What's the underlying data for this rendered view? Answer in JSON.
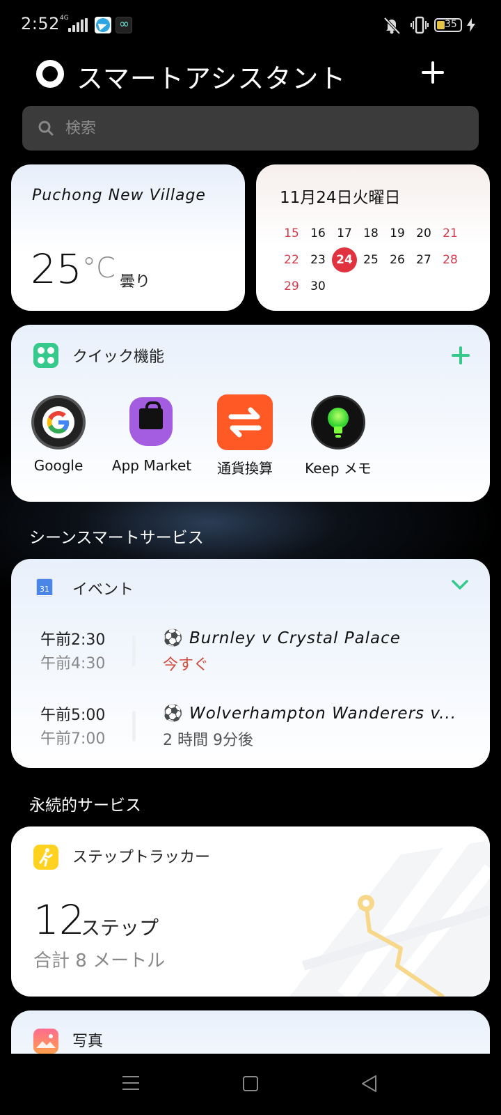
{
  "status": {
    "time": "2:52",
    "network": "4G",
    "battery": "35"
  },
  "header": {
    "title": "スマートアシスタント",
    "add_icon": "plus-icon"
  },
  "search": {
    "placeholder": "検索"
  },
  "weather": {
    "location": "Puchong New Village",
    "temperature": "25",
    "unit": "°C",
    "condition": "曇り"
  },
  "calendar": {
    "date_label": "11月24日火曜日",
    "rows": [
      [
        "15",
        "16",
        "17",
        "18",
        "19",
        "20",
        "21"
      ],
      [
        "22",
        "23",
        "24",
        "25",
        "26",
        "27",
        "28"
      ],
      [
        "29",
        "30"
      ]
    ],
    "today": "24"
  },
  "quick": {
    "title": "クイック機能",
    "apps": [
      {
        "label": "Google",
        "icon": "google-icon"
      },
      {
        "label": "App Market",
        "icon": "app-market-icon"
      },
      {
        "label": "通貨換算",
        "icon": "currency-exchange-icon"
      },
      {
        "label": "Keep メモ",
        "icon": "keep-notes-icon"
      }
    ]
  },
  "scene_section": {
    "label": "シーンスマートサービス"
  },
  "events": {
    "title": "イベント",
    "calendar_icon_number": "31",
    "items": [
      {
        "start": "午前2:30",
        "end": "午前4:30",
        "name": "Burnley v Crystal Palace",
        "status": "今すぐ"
      },
      {
        "start": "午前5:00",
        "end": "午前7:00",
        "name": "Wolverhampton Wanderers v...",
        "status": "2 時間 9分後"
      }
    ],
    "ball": "⚽"
  },
  "persistent_section": {
    "label": "永続的サービス"
  },
  "steps": {
    "title": "ステップトラッカー",
    "count": "12",
    "unit": "ステップ",
    "total": "合計 8 メートル"
  },
  "photos": {
    "title": "写真"
  },
  "colors": {
    "accent_green": "#35c98c",
    "today_red": "#e0323f",
    "status_red": "#d24a3a"
  }
}
